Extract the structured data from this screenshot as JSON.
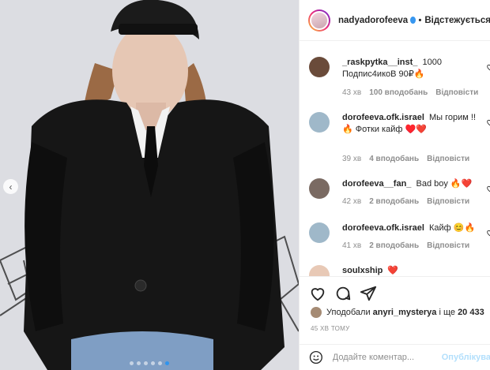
{
  "post": {
    "carousel_slides": 6,
    "active_slide": 6
  },
  "header": {
    "username": "nadyadorofeeva",
    "separator": "•",
    "follow_label": "Відстежується"
  },
  "comments": [
    {
      "username": "_raskpytka__inst_",
      "text": "1000 Подпис4икоВ 90₽🔥",
      "time": "43 хв",
      "likes": "100 вподобань",
      "reply": "Відповісти",
      "avatar_color": "#6a4b3a"
    },
    {
      "username": "dorofeeva.ofk.israel",
      "text": "Мы горим !! 🔥 Фотки кайф ♥️❤️",
      "time": "39 хв",
      "likes": "4 вподобань",
      "reply": "Відповісти",
      "avatar_color": "#9fb8c9"
    },
    {
      "username": "dorofeeva__fan_",
      "text": "Bad boy 🔥❤️",
      "time": "42 хв",
      "likes": "2 вподобань",
      "reply": "Відповісти",
      "avatar_color": "#7a6a62"
    },
    {
      "username": "dorofeeva.ofk.israel",
      "text": "Кайф 😊🔥",
      "time": "41 хв",
      "likes": "2 вподобань",
      "reply": "Відповісти",
      "avatar_color": "#9fb8c9"
    },
    {
      "username": "soulxship",
      "text": "❤️",
      "avatar_color": "#e8c9b6"
    }
  ],
  "likes_line": {
    "prefix": "Уподобали",
    "user": "anyri_mysterya",
    "middle": "і ще",
    "count": "20 433"
  },
  "timestamp": "45 ХВ ТОМУ",
  "add_comment": {
    "placeholder": "Додайте коментар...",
    "post_label": "Опублікува"
  },
  "colors": {
    "accent": "#3897f0",
    "post_disabled": "#b2dffc",
    "muted": "#8e8e8e"
  },
  "icons": [
    "heart-icon",
    "comment-icon",
    "share-icon",
    "emoji-icon",
    "chevron-left-icon",
    "verified-icon"
  ]
}
